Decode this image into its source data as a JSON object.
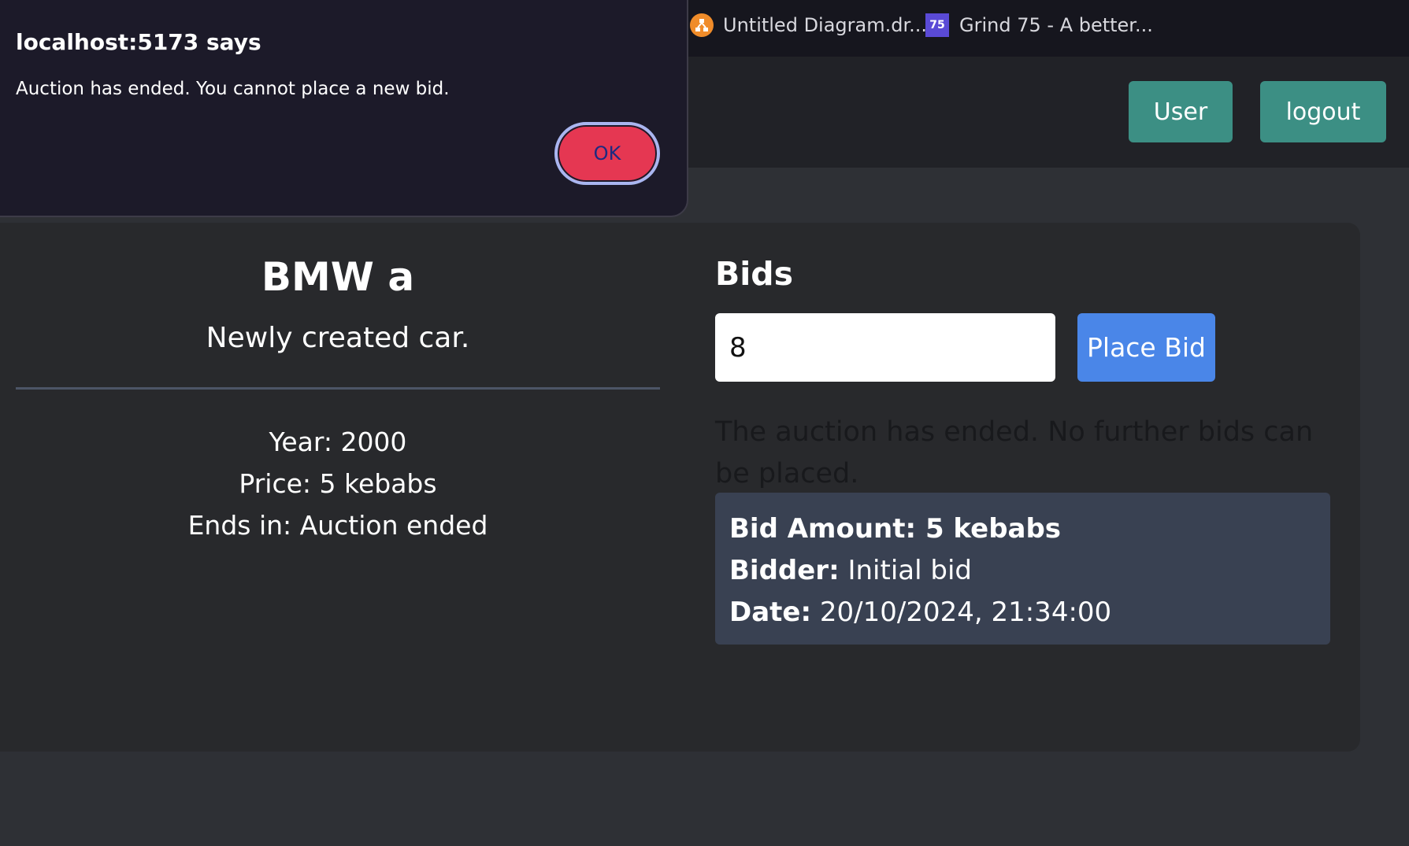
{
  "browser": {
    "bookmarks": [
      {
        "label": "Untitled Diagram.dr...",
        "icon": "drawio-icon"
      },
      {
        "label": "Grind 75 - A better...",
        "icon": "grind75-icon",
        "icon_text": "75"
      }
    ]
  },
  "header": {
    "user_label": "User",
    "logout_label": "logout"
  },
  "car": {
    "title": "BMW a",
    "description": "Newly created car.",
    "year": "Year: 2000",
    "price": "Price: 5 kebabs",
    "ends_in": "Ends in: Auction ended"
  },
  "bids": {
    "heading": "Bids",
    "input_value": "8",
    "place_bid_label": "Place Bid",
    "ended_message": "The auction has ended. No further bids can be placed.",
    "items": [
      {
        "amount_label": "Bid Amount: 5 kebabs",
        "bidder_label": "Bidder:",
        "bidder_value": " Initial bid",
        "date_label": "Date:",
        "date_value": " 20/10/2024, 21:34:00"
      }
    ]
  },
  "dialog": {
    "title": "localhost:5173 says",
    "message": "Auction has ended. You cannot place a new bid.",
    "ok_label": "OK"
  },
  "colors": {
    "accent_header_button": "#3c8f84",
    "place_bid_button": "#4a86e8",
    "ok_button": "#e53752",
    "bid_card": "#394152"
  }
}
